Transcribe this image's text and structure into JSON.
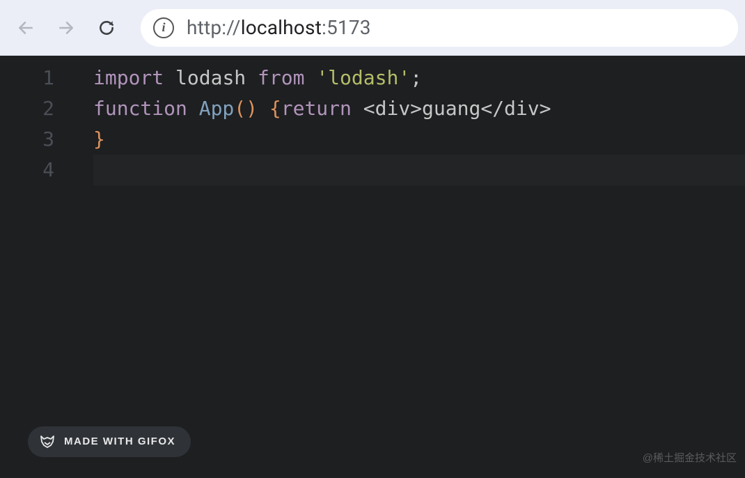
{
  "toolbar": {
    "back_enabled": false,
    "forward_enabled": false,
    "url_scheme": "http://",
    "url_host": "localhost",
    "url_port": ":5173"
  },
  "editor": {
    "line_numbers": [
      "1",
      "2",
      "3",
      "4"
    ],
    "active_line_index": 3,
    "tokens": [
      [
        {
          "t": "import",
          "c": "kw"
        },
        {
          "t": " ",
          "c": "id"
        },
        {
          "t": "lodash",
          "c": "id"
        },
        {
          "t": " ",
          "c": "id"
        },
        {
          "t": "from",
          "c": "kw"
        },
        {
          "t": " ",
          "c": "id"
        },
        {
          "t": "'lodash'",
          "c": "str"
        },
        {
          "t": ";",
          "c": "punc"
        }
      ],
      [
        {
          "t": "function",
          "c": "kw"
        },
        {
          "t": " ",
          "c": "id"
        },
        {
          "t": "App",
          "c": "fn"
        },
        {
          "t": "()",
          "c": "br"
        },
        {
          "t": " ",
          "c": "id"
        },
        {
          "t": "{",
          "c": "br"
        },
        {
          "t": "return",
          "c": "kw"
        },
        {
          "t": " ",
          "c": "id"
        },
        {
          "t": "<div>",
          "c": "tag"
        },
        {
          "t": "guang",
          "c": "id"
        },
        {
          "t": "</div>",
          "c": "tag"
        }
      ],
      [
        {
          "t": "}",
          "c": "br"
        }
      ],
      []
    ]
  },
  "gifox": {
    "label": "MADE WITH GIFOX"
  },
  "watermark": "@稀土掘金技术社区"
}
